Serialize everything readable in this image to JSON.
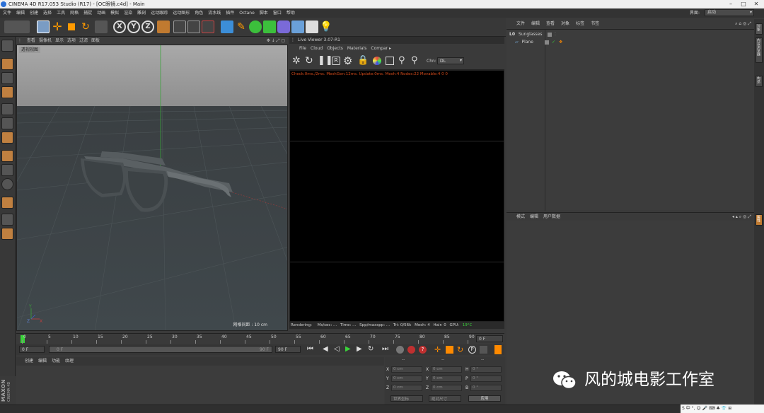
{
  "app": {
    "title": "CINEMA 4D R17.053 Studio (R17) - [OC眼镜.c4d] - Main",
    "layout_label": "界面:",
    "layout_value": "启动"
  },
  "menu": [
    "文件",
    "编辑",
    "创建",
    "选择",
    "工具",
    "网格",
    "捕捉",
    "动画",
    "模拟",
    "渲染",
    "雕刻",
    "运动跟踪",
    "运动图形",
    "角色",
    "流水线",
    "插件",
    "Octane",
    "脚本",
    "窗口",
    "帮助"
  ],
  "viewport": {
    "menu": [
      "查看",
      "摄像机",
      "显示",
      "选项",
      "过滤",
      "面板"
    ],
    "label": "透视视图",
    "grid_spacing": "网格间距 : 10 cm"
  },
  "live_viewer": {
    "title": "Live Viewer 3.07-R1",
    "menu": [
      "File",
      "Cloud",
      "Objects",
      "Materials",
      "Compar ▸"
    ],
    "channel_label": "Chn:",
    "channel_value": "DL",
    "stats": "Check:0ms./2ms. MeshGen:12ms. Update:0ms. Mesh:4 Nodes:22 Movable:4  0 0",
    "status": {
      "rendering": "Rendering:",
      "ms_sec": "Ms/sec: ...",
      "time": "Time: ...",
      "spp": "Spp/maxspp: ...",
      "tri": "Tri: 0/56k",
      "mesh": "Mesh: 4",
      "hair": "Hair: 0",
      "gpu": "GPU:",
      "temp": "19°C"
    }
  },
  "object_manager": {
    "menu": [
      "文件",
      "编辑",
      "查看",
      "对象",
      "标签",
      "书签"
    ],
    "objects": [
      {
        "name": "Sunglasses",
        "icon": "null-object-icon"
      },
      {
        "name": "Plane",
        "icon": "plane-icon"
      }
    ]
  },
  "attributes": {
    "menu": [
      "模式",
      "编辑",
      "用户数据"
    ]
  },
  "side_tabs": [
    "对象",
    "内容浏览器",
    "构造",
    "属性"
  ],
  "timeline": {
    "ticks": [
      "0",
      "5",
      "10",
      "15",
      "20",
      "25",
      "30",
      "35",
      "40",
      "45",
      "50",
      "55",
      "60",
      "65",
      "70",
      "75",
      "80",
      "85",
      "90"
    ],
    "end_field": "0 F",
    "current_frame": "0 F",
    "start_field": "0 F",
    "range_end_inner": "90 F",
    "range_end": "90 F"
  },
  "materials": {
    "menu": [
      "创建",
      "编辑",
      "功能",
      "纹理"
    ]
  },
  "coordinates": {
    "headers": [
      "--",
      "--",
      "--"
    ],
    "rows": [
      {
        "a": "X",
        "av": "0 cm",
        "b": "X",
        "bv": "0 cm",
        "c": "H",
        "cv": "0 °"
      },
      {
        "a": "Y",
        "av": "0 cm",
        "b": "Y",
        "bv": "0 cm",
        "c": "P",
        "cv": "0 °"
      },
      {
        "a": "Z",
        "av": "0 cm",
        "b": "Z",
        "bv": "0 cm",
        "c": "B",
        "cv": "0 °"
      }
    ],
    "mode1": "世界坐标",
    "mode2": "绝对尺寸",
    "apply": "应用"
  },
  "branding": {
    "maxon": "MAXON",
    "cinema": "CINEMA 4D"
  },
  "watermark": "风的城电影工作室",
  "ime_bar": "S 中 °, ☺ 🎤 ⌨ ♣ 👕 ⊞",
  "colors": {
    "accent": "#ff8a00",
    "axis_y": "#3aa33a",
    "stats_text": "#d24a1a",
    "gpu_temp": "#3ad23a"
  }
}
